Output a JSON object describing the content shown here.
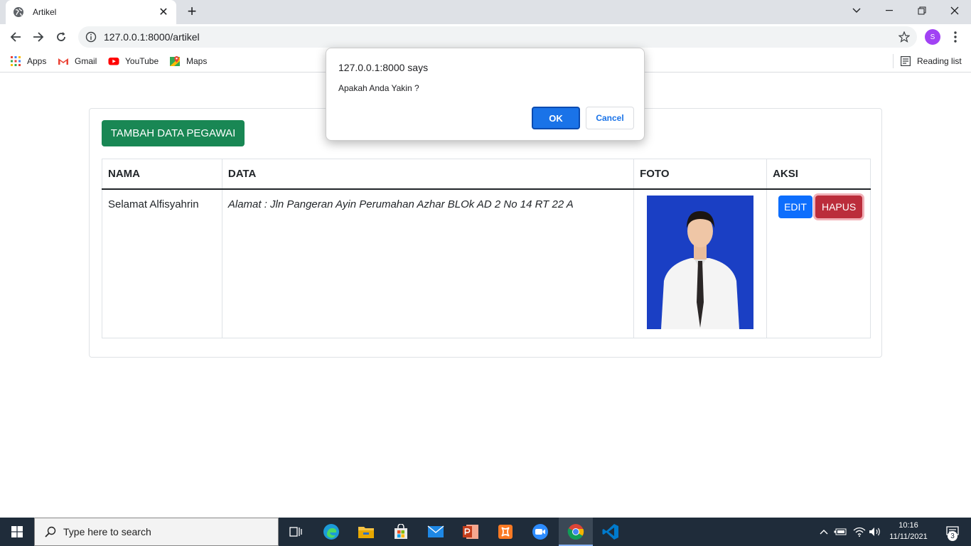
{
  "browser": {
    "tab_title": "Artikel",
    "url": "127.0.0.1:8000/artikel",
    "profile_initial": "S",
    "bookmarks": [
      {
        "label": "Apps"
      },
      {
        "label": "Gmail"
      },
      {
        "label": "YouTube"
      },
      {
        "label": "Maps"
      }
    ],
    "reading_list": "Reading list"
  },
  "page": {
    "add_button": "TAMBAH DATA PEGAWAI",
    "table": {
      "headers": [
        "NAMA",
        "DATA",
        "FOTO",
        "AKSI"
      ],
      "rows": [
        {
          "nama": "Selamat Alfisyahrin",
          "data": "Alamat : Jln Pangeran Ayin Perumahan Azhar BLOk AD 2 No 14 RT 22 A",
          "edit": "EDIT",
          "hapus": "HAPUS"
        }
      ]
    }
  },
  "dialog": {
    "origin": "127.0.0.1:8000 says",
    "message": "Apakah Anda Yakin ?",
    "ok": "OK",
    "cancel": "Cancel"
  },
  "taskbar": {
    "search_placeholder": "Type here to search",
    "time": "10:16",
    "date": "11/11/2021",
    "notifications": "3"
  },
  "colors": {
    "add_button": "#198754",
    "edit_button": "#0d6efd",
    "hapus_button": "#bb2d3b",
    "dialog_ok": "#1a73e8",
    "photo_background": "#1a3fc4"
  }
}
